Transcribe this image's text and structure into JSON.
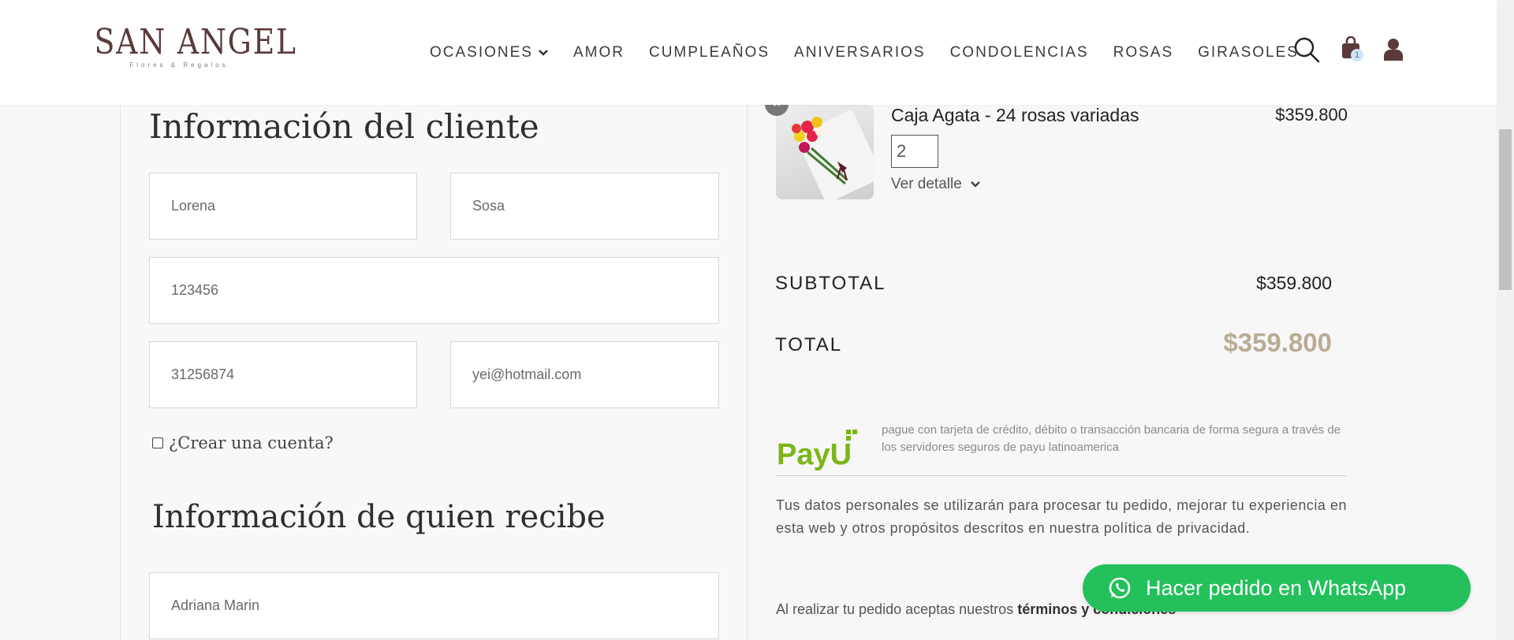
{
  "brand": {
    "name": "SAN ANGEL",
    "tagline": "Flores & Regalos"
  },
  "nav": {
    "items": [
      {
        "label": "OCASIONES",
        "dropdown": true
      },
      {
        "label": "AMOR"
      },
      {
        "label": "CUMPLEAÑOS"
      },
      {
        "label": "ANIVERSARIOS"
      },
      {
        "label": "CONDOLENCIAS"
      },
      {
        "label": "ROSAS"
      },
      {
        "label": "GIRASOLES"
      }
    ],
    "icons": [
      "search-icon",
      "cart-icon",
      "user-icon"
    ],
    "cart_count": "1"
  },
  "customer": {
    "title": "Información del cliente",
    "first_name": "Lorena",
    "last_name": "Sosa",
    "document": "123456",
    "phone": "31256874",
    "email": "yei@hotmail.com",
    "create_account_label": "¿Crear una cuenta?"
  },
  "recipient": {
    "title": "Información de quien recibe",
    "name": "Adriana Marin"
  },
  "cart": {
    "product_name": "Caja Agata - 24 rosas variadas",
    "product_price": "$359.800",
    "quantity": "2",
    "detail_label": "Ver detalle",
    "remove_label": "×"
  },
  "summary": {
    "subtotal_label": "SUBTOTAL",
    "subtotal_value": "$359.800",
    "total_label": "TOTAL",
    "total_value": "$359.800"
  },
  "payment": {
    "description": "pague con tarjeta de crédito, débito o transacción bancaria de forma segura a través de los servidores seguros de payu latinoamerica",
    "logo_text": "PayU"
  },
  "privacy_text": "Tus datos personales se utilizarán para procesar tu pedido, mejorar tu experiencia en esta web y otros propósitos descritos en nuestra política de privacidad.",
  "terms": {
    "prefix": "Al realizar tu pedido aceptas nuestros",
    "link": "términos y condiciones"
  },
  "whatsapp_button": "Hacer pedido en WhatsApp",
  "colors": {
    "brand": "#5a3a3a",
    "total_accent": "#b9ac95",
    "whatsapp": "#23c05c",
    "payu_green": "#7cb518"
  }
}
